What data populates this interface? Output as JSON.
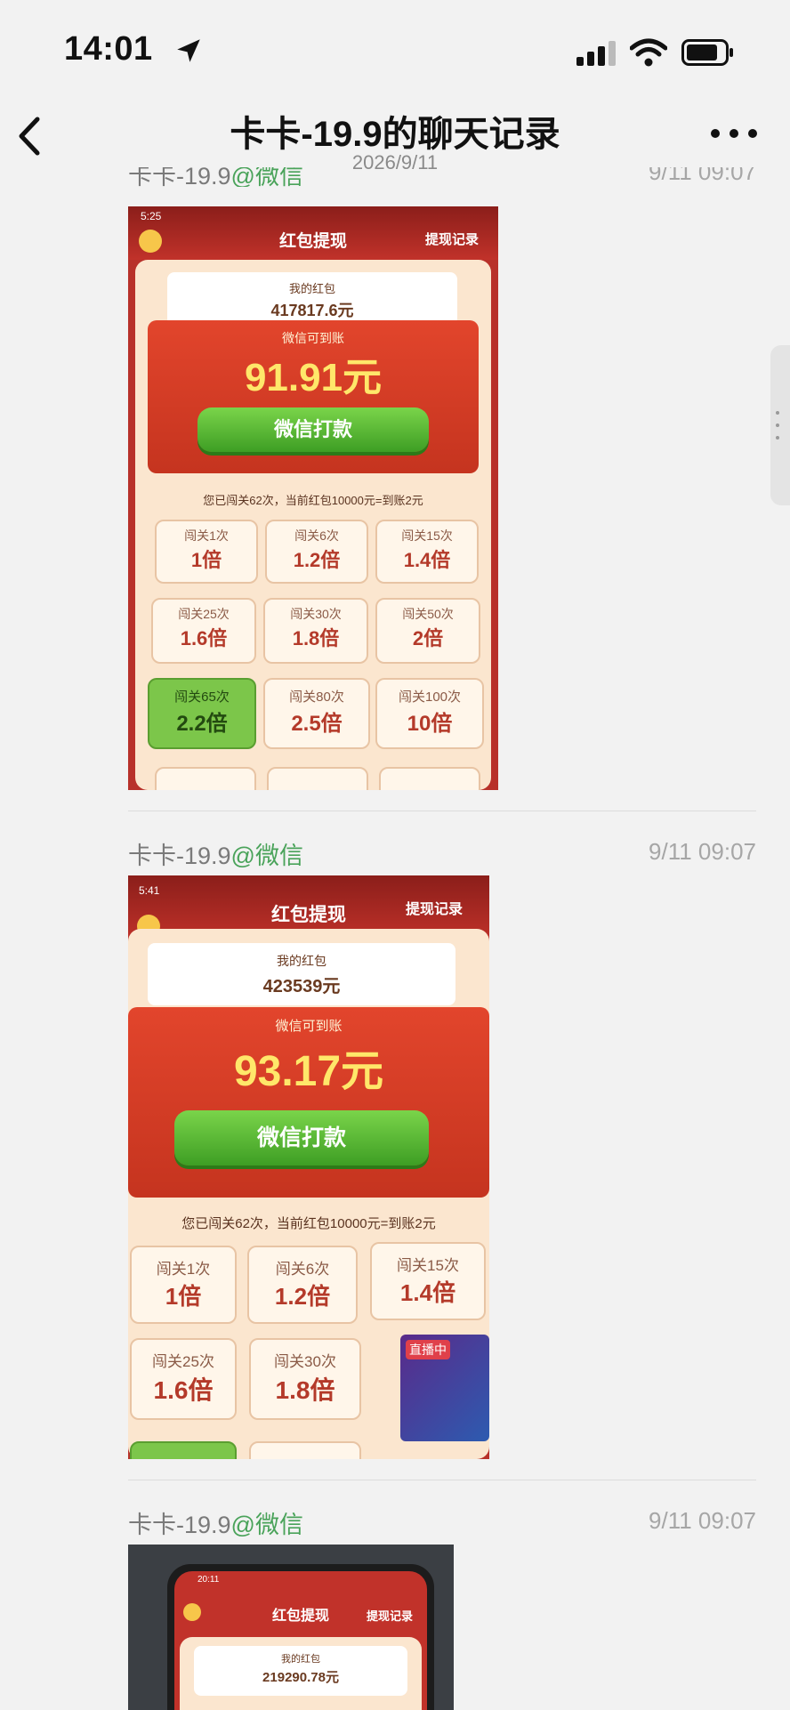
{
  "status_bar": {
    "time": "14:01"
  },
  "header": {
    "title": "卡卡-19.9的聊天记录",
    "date": "2026/9/11"
  },
  "messages": [
    {
      "sender": "卡卡-19.9",
      "source": "@微信",
      "time": "9/11 09:07",
      "screenshot": {
        "clock": "5:25",
        "title": "红包提现",
        "record_link": "提现记录",
        "wallet_label": "我的红包",
        "wallet_amount": "417817.6元",
        "wechat_label": "微信可到账",
        "amount": "91.91元",
        "button": "微信打款",
        "note": "您已闯关62次，当前红包10000元=到账2元",
        "tiles": [
          {
            "label": "闯关1次",
            "value": "1倍"
          },
          {
            "label": "闯关6次",
            "value": "1.2倍"
          },
          {
            "label": "闯关15次",
            "value": "1.4倍"
          },
          {
            "label": "闯关25次",
            "value": "1.6倍"
          },
          {
            "label": "闯关30次",
            "value": "1.8倍"
          },
          {
            "label": "闯关50次",
            "value": "2倍"
          },
          {
            "label": "闯关65次",
            "value": "2.2倍"
          },
          {
            "label": "闯关80次",
            "value": "2.5倍"
          },
          {
            "label": "闯关100次",
            "value": "10倍"
          }
        ]
      }
    },
    {
      "sender": "卡卡-19.9",
      "source": "@微信",
      "time": "9/11 09:07",
      "screenshot": {
        "clock": "5:41",
        "title": "红包提现",
        "record_link": "提现记录",
        "wallet_label": "我的红包",
        "wallet_amount": "423539元",
        "wechat_label": "微信可到账",
        "amount": "93.17元",
        "button": "微信打款",
        "note": "您已闯关62次，当前红包10000元=到账2元",
        "tiles": [
          {
            "label": "闯关1次",
            "value": "1倍"
          },
          {
            "label": "闯关6次",
            "value": "1.2倍"
          },
          {
            "label": "闯关15次",
            "value": "1.4倍"
          },
          {
            "label": "闯关25次",
            "value": "1.6倍"
          },
          {
            "label": "闯关30次",
            "value": "1.8倍"
          }
        ],
        "live_badge": "直播中"
      }
    },
    {
      "sender": "卡卡-19.9",
      "source": "@微信",
      "time": "9/11 09:07",
      "screenshot": {
        "clock": "20:11",
        "title": "红包提现",
        "record_link": "提现记录",
        "wallet_label": "我的红包",
        "wallet_amount": "219290.78元"
      }
    }
  ],
  "colors": {
    "accent_green": "#4aa35a",
    "envelope_red": "#c5341f",
    "button_green": "#3e9e24",
    "amount_yellow": "#ffe76a"
  }
}
